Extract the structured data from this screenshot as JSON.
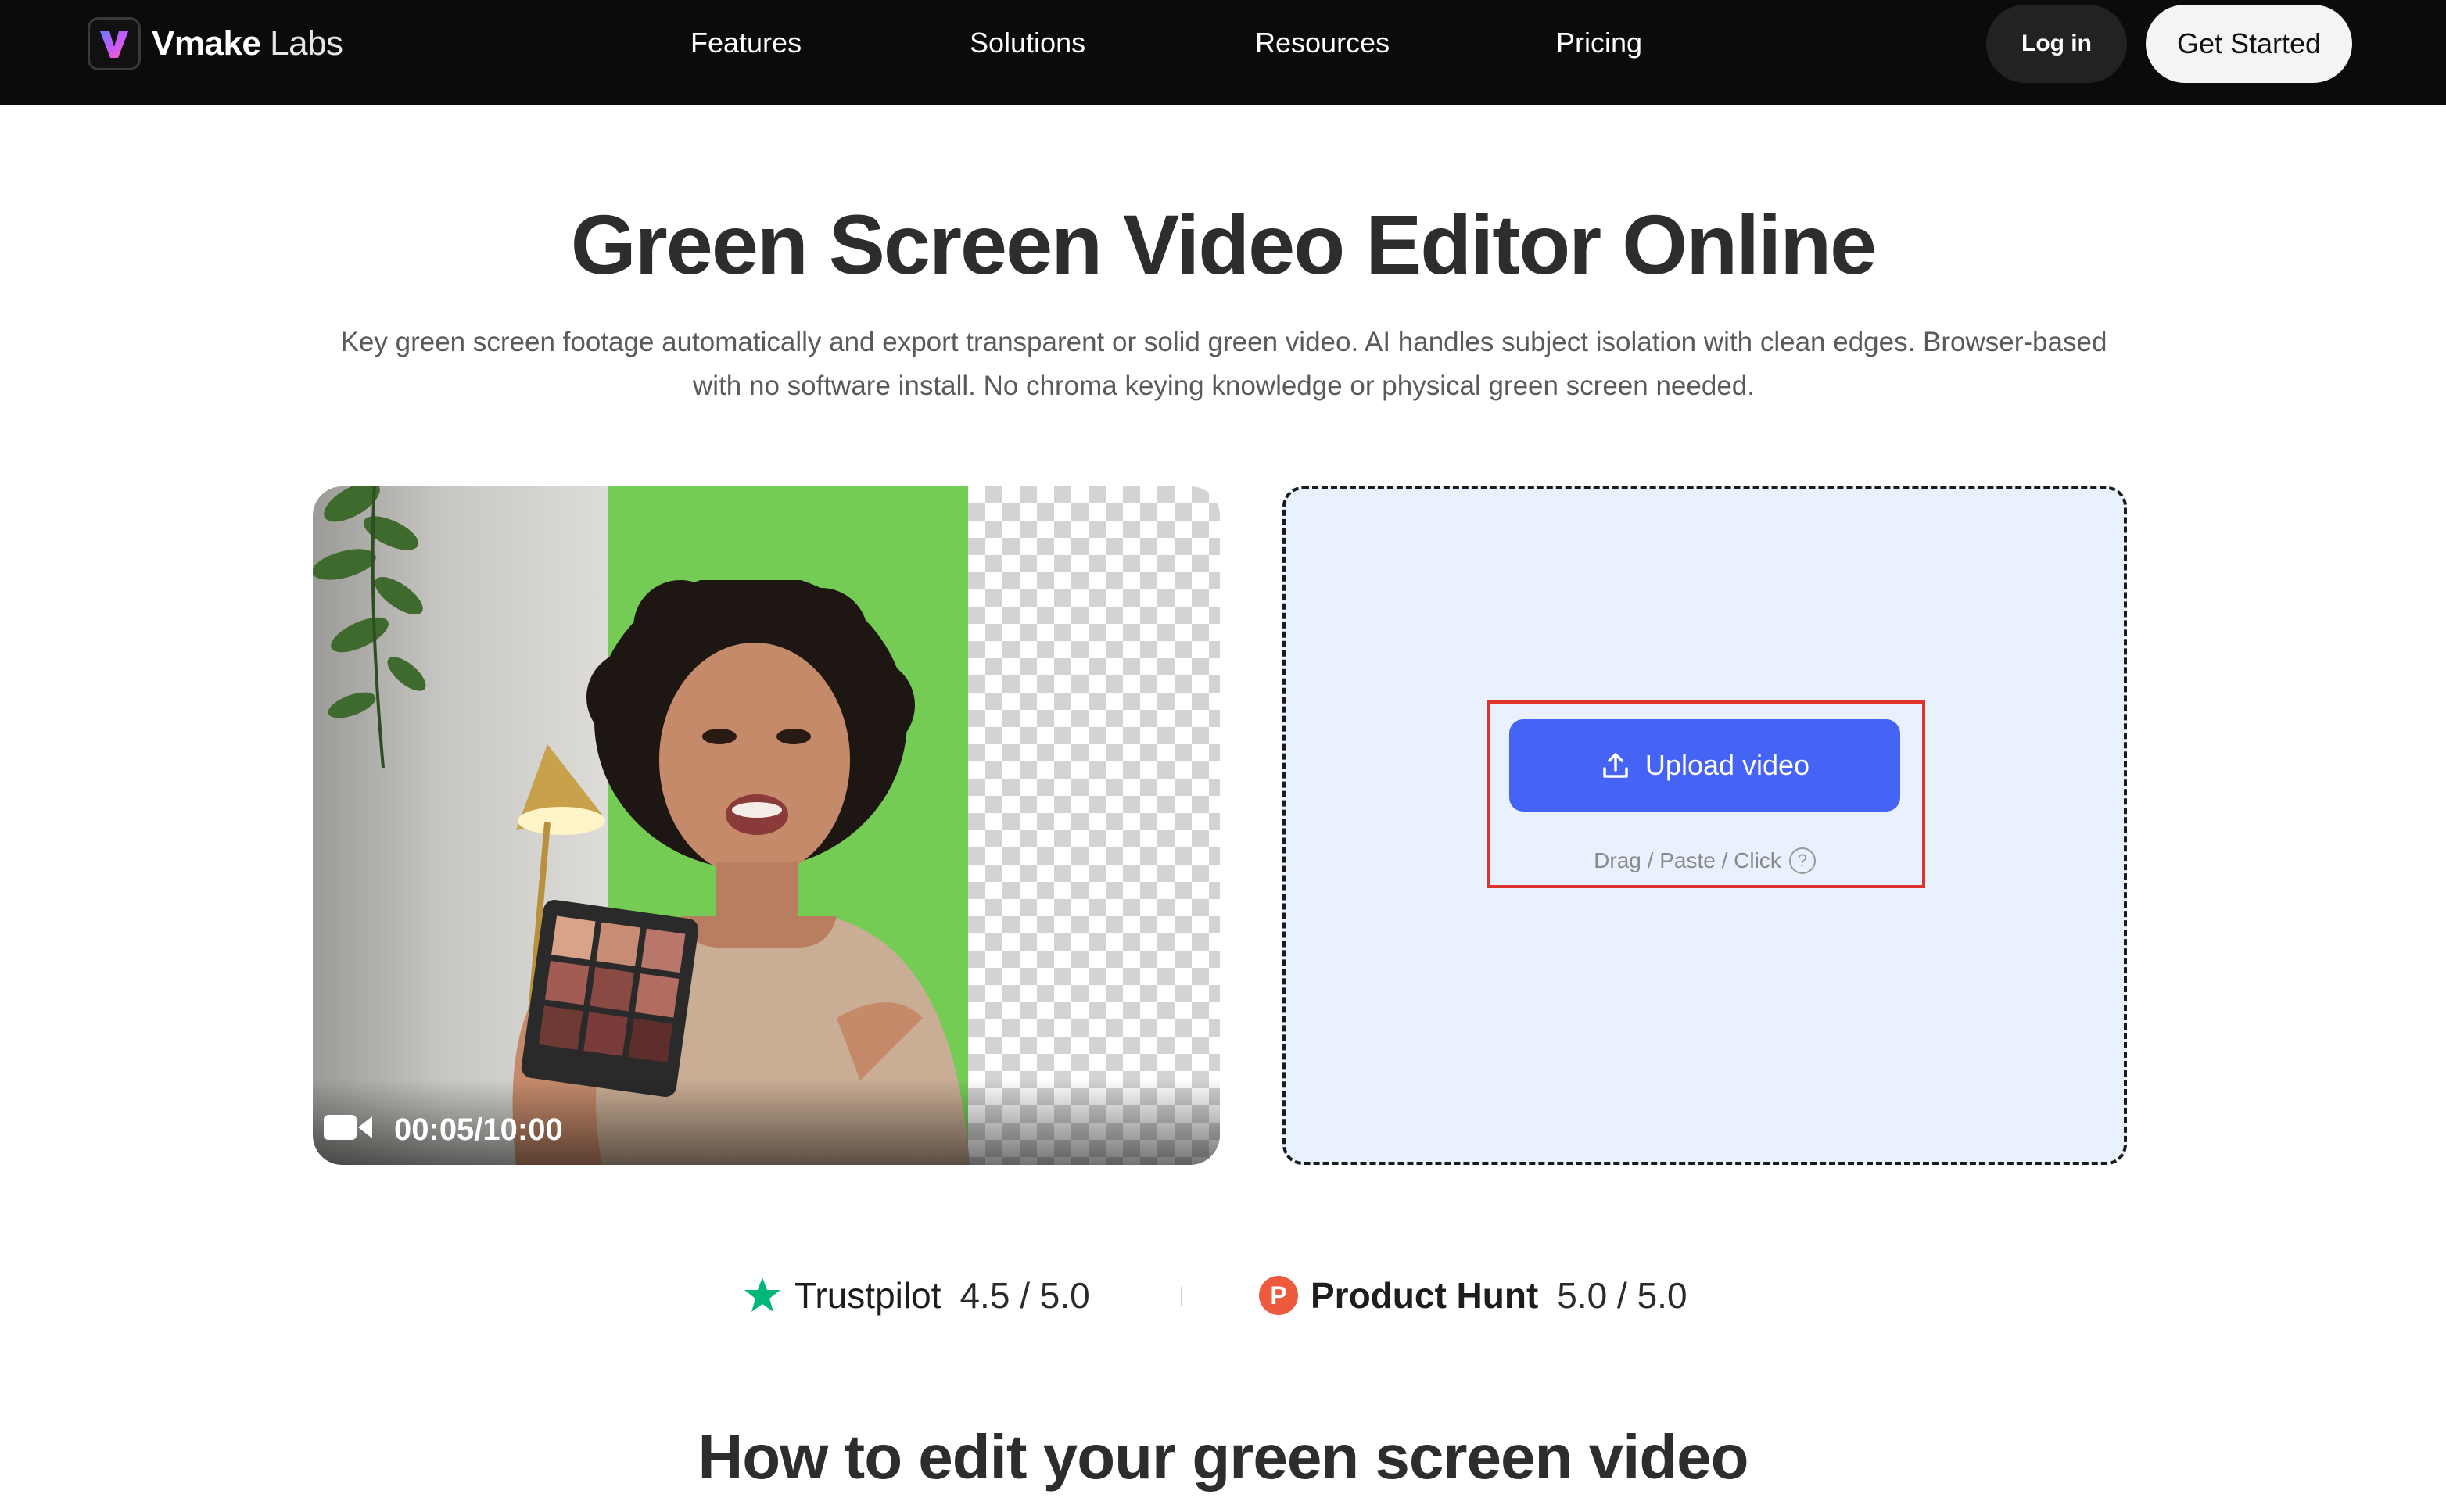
{
  "nav": {
    "logo_brand": "Vmake",
    "logo_suffix": "Labs",
    "links": [
      "Features",
      "Solutions",
      "Resources",
      "Pricing"
    ],
    "login_label": "Log in",
    "get_started_label": "Get Started"
  },
  "hero": {
    "title": "Green Screen Video Editor Online",
    "subtitle": "Key green screen footage automatically and export transparent or solid green video. AI handles subject isolation with clean edges. Browser-based with no software install. No chroma keying knowledge or physical green screen needed."
  },
  "preview": {
    "timestamp": "00:05/10:00"
  },
  "upload": {
    "button_label": "Upload video",
    "hint": "Drag / Paste / Click",
    "help_glyph": "?"
  },
  "ratings": [
    {
      "brand": "Trustpilot",
      "score": "4.5 / 5.0"
    },
    {
      "brand": "Product Hunt",
      "score": "5.0 / 5.0",
      "badge": "P"
    }
  ],
  "section": {
    "title": "How to edit your green screen video"
  },
  "colors": {
    "nav_bg": "#0b0b0b",
    "accent_blue": "#4563f5",
    "dropzone_bg": "#e8f1fd",
    "highlight_red": "#e0332c",
    "trustpilot_green": "#00b67a",
    "producthunt_orange": "#ee5a3e",
    "green_screen": "#74cc55"
  }
}
